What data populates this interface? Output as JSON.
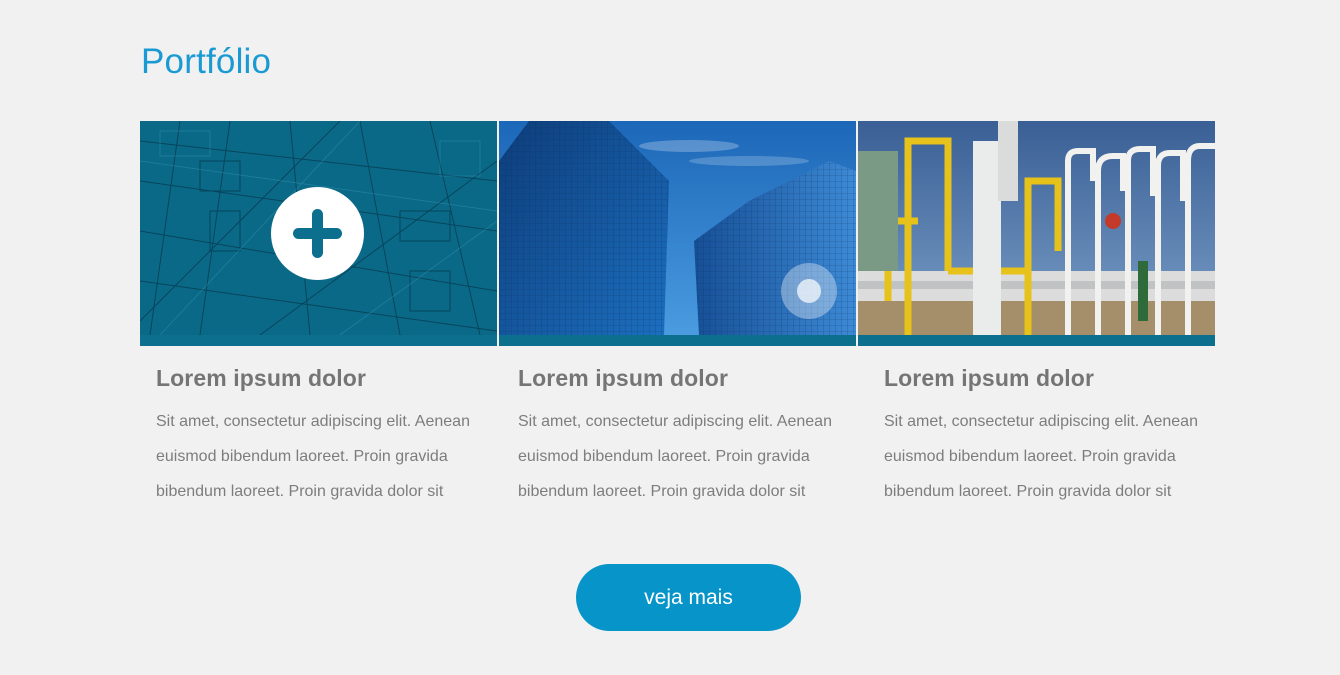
{
  "section": {
    "title": "Portfólio"
  },
  "cards": [
    {
      "image": "blueprint-image",
      "title": "Lorem ipsum dolor",
      "description": "Sit amet, consectetur adipiscing elit. Aenean euismod bibendum laoreet. Proin gravida bibendum laoreet. Proin gravida dolor sit"
    },
    {
      "image": "skyscraper-image",
      "title": "Lorem ipsum dolor",
      "description": "Sit amet, consectetur adipiscing elit. Aenean euismod bibendum laoreet. Proin gravida bibendum laoreet. Proin gravida dolor sit"
    },
    {
      "image": "industrial-pipes-image",
      "title": "Lorem ipsum dolor",
      "description": "Sit amet, consectetur adipiscing elit. Aenean euismod bibendum laoreet. Proin gravida bibendum laoreet. Proin gravida dolor sit"
    }
  ],
  "overlay_icon": "plus-icon",
  "cta": {
    "label": "veja mais"
  },
  "colors": {
    "accent": "#1a9ad2",
    "button": "#0795c9",
    "bar": "#0b6f8d",
    "background": "#f1f1f1",
    "title_text": "#757575",
    "body_text": "#7d7d7d"
  }
}
